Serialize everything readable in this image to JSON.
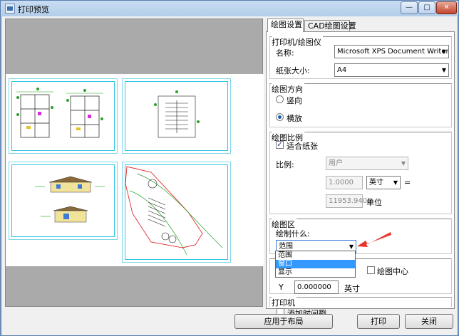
{
  "window": {
    "title": "打印预览",
    "min": "—",
    "max": "□",
    "close": "✕"
  },
  "tabs": [
    {
      "label": "绘图设置"
    },
    {
      "label": "CAD绘图设置"
    }
  ],
  "printer_group": {
    "title": "打印机/绘图仪",
    "name_label": "名称:",
    "name_value": "Microsoft XPS Document Writer",
    "paper_label": "纸张大小:",
    "paper_value": "A4"
  },
  "orientation_group": {
    "title": "绘图方向",
    "portrait": "竖向",
    "landscape": "横放",
    "selected": "横放"
  },
  "scale_group": {
    "title": "绘图比例",
    "fit_label": "适合纸张",
    "fit_checked": true,
    "scale_label": "比例:",
    "scale_value": "用户",
    "value1": "1.0000",
    "unit_value": "英寸",
    "equals": "=",
    "value2": "11953.9400",
    "unit_label": "单位"
  },
  "area_group": {
    "title": "绘图区",
    "what_label": "绘制什么:",
    "what_value": "范围",
    "options": [
      "范围",
      "窗口",
      "显示"
    ],
    "highlighted": "窗口"
  },
  "offset_group": {
    "center_label": "绘图中心",
    "y_label": "Y",
    "y_value": "0.000000",
    "y_unit": "英寸"
  },
  "plot_group": {
    "title": "打印机",
    "timestamp_label": "添加时间戳"
  },
  "buttons": {
    "apply": "应用于布局",
    "print": "打印",
    "close": "关闭"
  },
  "colors": {
    "titlebar": "#b3cde9",
    "preview_bg": "#aaaaaa",
    "sheet_border": "#2ec6e6",
    "highlight": "#3399ff",
    "arrow": "#e8332a"
  }
}
